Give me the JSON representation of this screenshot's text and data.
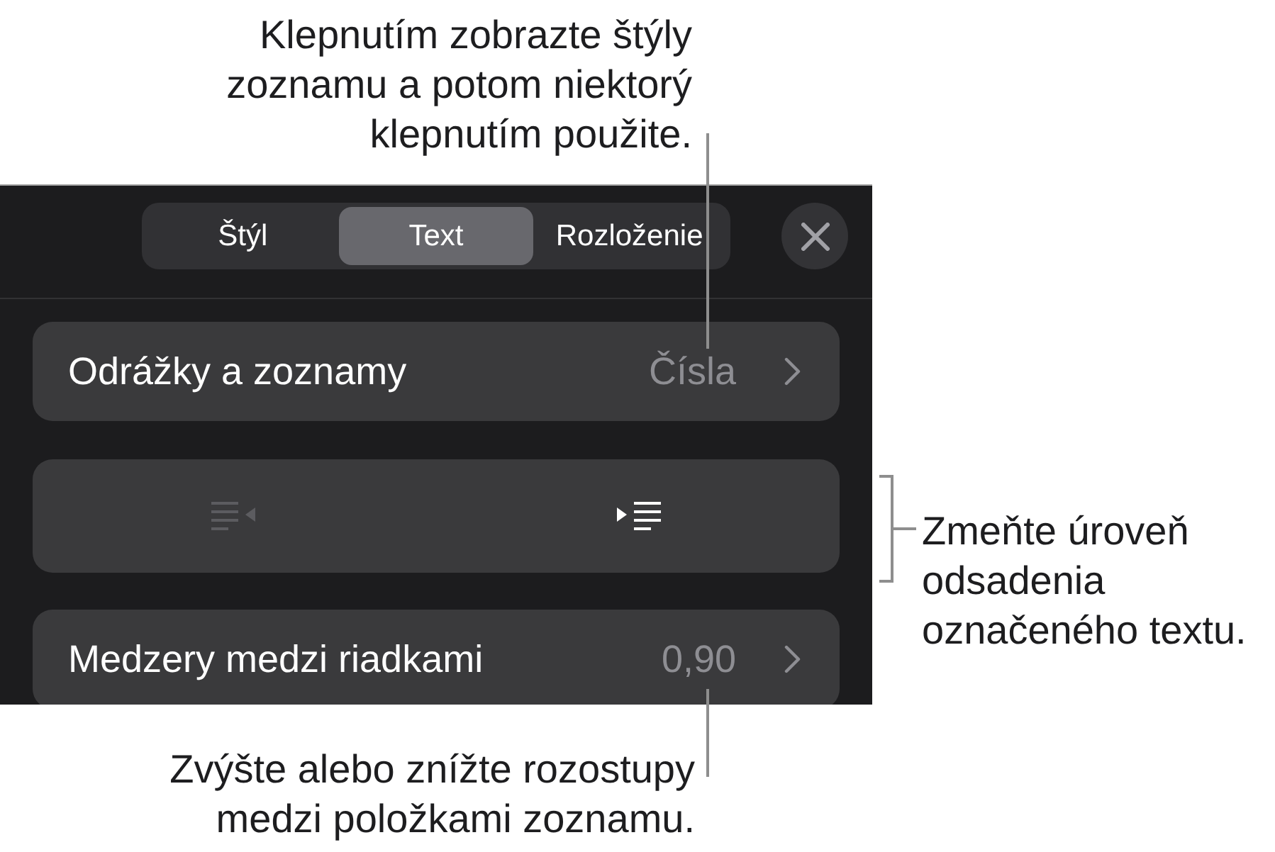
{
  "top_callout": "Klepnutím zobrazte štýly zoznamu a potom niektorý klepnutím použite.",
  "panel": {
    "tabs": [
      {
        "label": "Štýl",
        "selected": false
      },
      {
        "label": "Text",
        "selected": true
      },
      {
        "label": "Rozloženie",
        "selected": false
      }
    ],
    "rows": [
      {
        "kind": "disclosure",
        "label": "Odrážky a zoznamy",
        "value": "Čísla"
      },
      {
        "kind": "indent",
        "buttons": [
          {
            "kind": "outdent",
            "disabled": true
          },
          {
            "kind": "indent",
            "disabled": false
          }
        ]
      },
      {
        "kind": "disclosure",
        "label": "Medzery medzi riadkami",
        "value": "0,90"
      }
    ]
  },
  "right_callout": "Zmeňte úroveň odsadenia označeného textu.",
  "bottom_callout": "Zvýšte alebo znížte rozostupy medzi položkami zoznamu."
}
